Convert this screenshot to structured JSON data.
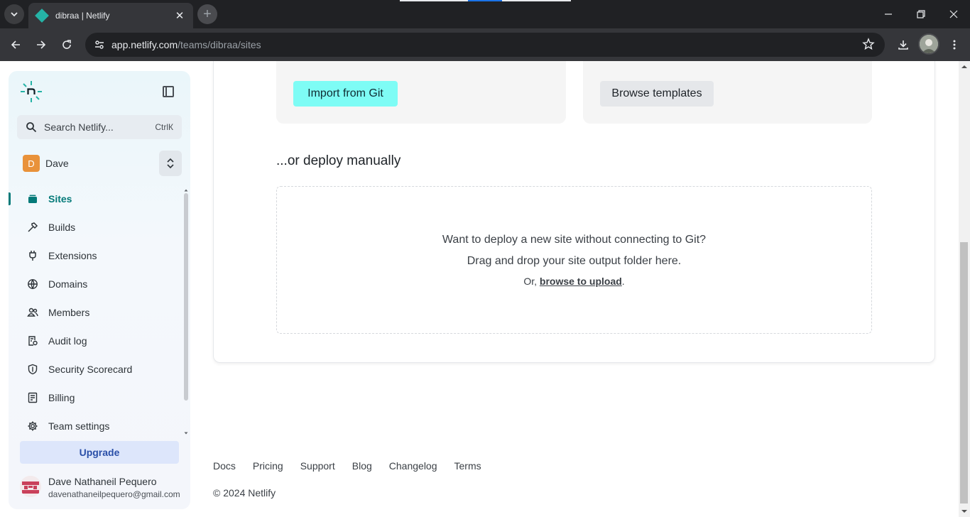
{
  "browser": {
    "tab_title": "dibraa | Netlify",
    "url_host": "app.netlify.com",
    "url_path": "/teams/dibraa/sites"
  },
  "sidebar": {
    "search_placeholder": "Search Netlify...",
    "search_shortcut": "CtrlК",
    "team_initial": "D",
    "team_name": "Dave",
    "items": [
      {
        "label": "Sites",
        "icon": "layers-icon",
        "active": true
      },
      {
        "label": "Builds",
        "icon": "hammer-icon"
      },
      {
        "label": "Extensions",
        "icon": "plug-icon"
      },
      {
        "label": "Domains",
        "icon": "globe-icon"
      },
      {
        "label": "Members",
        "icon": "people-icon"
      },
      {
        "label": "Audit log",
        "icon": "audit-log-icon"
      },
      {
        "label": "Security Scorecard",
        "icon": "shield-icon"
      },
      {
        "label": "Billing",
        "icon": "receipt-icon"
      },
      {
        "label": "Team settings",
        "icon": "gear-icon"
      }
    ],
    "upgrade_label": "Upgrade",
    "user_name": "Dave Nathaneil Pequero",
    "user_email": "davenathaneilpequero@gmail.com"
  },
  "main": {
    "import_button": "Import from Git",
    "templates_button": "Browse templates",
    "manual_heading": "...or deploy manually",
    "dropzone_line1": "Want to deploy a new site without connecting to Git?",
    "dropzone_line2": "Drag and drop your site output folder here.",
    "dropzone_prefix": "Or, ",
    "dropzone_link": "browse to upload",
    "dropzone_suffix": "."
  },
  "footer": {
    "links": [
      "Docs",
      "Pricing",
      "Support",
      "Blog",
      "Changelog",
      "Terms"
    ],
    "copyright": "© 2024 Netlify"
  },
  "colors": {
    "accent": "#047a79",
    "import_button": "#7efcf5",
    "upgrade": "#dde6fb"
  }
}
